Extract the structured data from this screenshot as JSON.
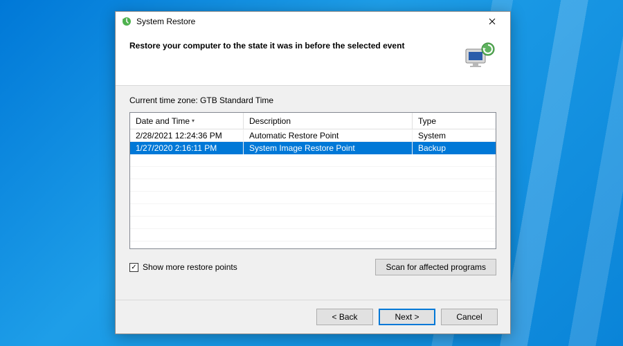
{
  "window": {
    "title": "System Restore",
    "instruction": "Restore your computer to the state it was in before the selected event"
  },
  "timezone": {
    "label": "Current time zone: GTB Standard Time"
  },
  "columns": {
    "date": "Date and Time",
    "desc": "Description",
    "type": "Type"
  },
  "rows": [
    {
      "date": "2/28/2021 12:24:36 PM",
      "desc": "Automatic Restore Point",
      "type": "System",
      "selected": false
    },
    {
      "date": "1/27/2020 2:16:11 PM",
      "desc": "System Image Restore Point",
      "type": "Backup",
      "selected": true
    }
  ],
  "checkbox": {
    "label": "Show more restore points",
    "checked": true
  },
  "buttons": {
    "scan": "Scan for affected programs",
    "back": "< Back",
    "next": "Next >",
    "cancel": "Cancel"
  }
}
